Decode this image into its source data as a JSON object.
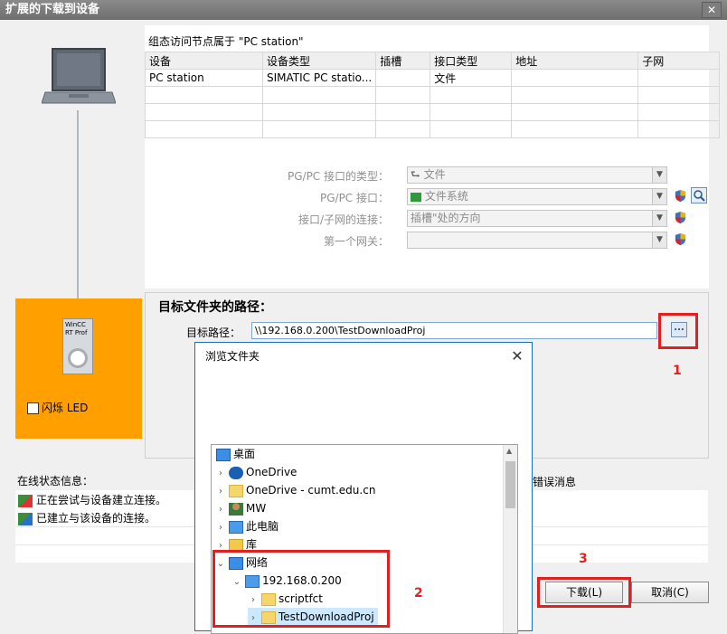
{
  "window": {
    "title": "扩展的下载到设备",
    "close_symbol": "✕"
  },
  "devices_section": {
    "caption": "组态访问节点属于 \"PC station\"",
    "columns": [
      "设备",
      "设备类型",
      "插槽",
      "接口类型",
      "地址",
      "子网"
    ],
    "rows": [
      [
        "PC station",
        "SIMATIC PC statio...",
        "",
        "文件",
        "",
        ""
      ],
      [
        "",
        "",
        "",
        "",
        "",
        ""
      ],
      [
        "",
        "",
        "",
        "",
        "",
        ""
      ],
      [
        "",
        "",
        "",
        "",
        "",
        ""
      ]
    ]
  },
  "form": {
    "pgpc_type_label": "PG/PC 接口的类型：",
    "pgpc_type_value": "文件",
    "pgpc_iface_label": "PG/PC 接口：",
    "pgpc_iface_value": "文件系统",
    "connection_label": "接口/子网的连接：",
    "connection_value": "插槽\"处的方向",
    "gateway_label": "第一个网关：",
    "gateway_value": ""
  },
  "device_panel": {
    "device_label_line1": "WinCC",
    "device_label_line2": "RT Prof",
    "flash_led_label": "闪烁 LED"
  },
  "target": {
    "title": "目标文件夹的路径：",
    "path_label": "目标路径：",
    "path_value": "\\\\192.168.0.200\\TestDownloadProj",
    "browse_label": "..."
  },
  "status": {
    "title": "在线状态信息：",
    "right_title": "错误消息",
    "messages": [
      "正在尝试与设备建立连接。",
      "已建立与该设备的连接。"
    ]
  },
  "buttons": {
    "download": "下载(L)",
    "cancel": "取消(C)"
  },
  "browse_dialog": {
    "title": "浏览文件夹",
    "close_symbol": "✕",
    "tree": [
      {
        "label": "桌面",
        "icon": "desktop-icon"
      },
      {
        "label": "OneDrive",
        "icon": "cloud-icon"
      },
      {
        "label": "OneDrive - cumt.edu.cn",
        "icon": "folder-icon"
      },
      {
        "label": "MW",
        "icon": "user-icon"
      },
      {
        "label": "此电脑",
        "icon": "computer-icon"
      },
      {
        "label": "库",
        "icon": "library-icon"
      },
      {
        "label": "网络",
        "icon": "network-icon"
      },
      {
        "label": "192.168.0.200",
        "icon": "computer-icon"
      },
      {
        "label": "scriptfct",
        "icon": "share-folder-icon"
      },
      {
        "label": "TestDownloadProj",
        "icon": "share-folder-icon"
      }
    ]
  },
  "annotations": {
    "step1": "1",
    "step2": "2",
    "step3": "3"
  },
  "colors": {
    "accent_orange": "#ff9f00",
    "annotation_red": "#e32020",
    "selection_blue": "#cce8ff"
  }
}
